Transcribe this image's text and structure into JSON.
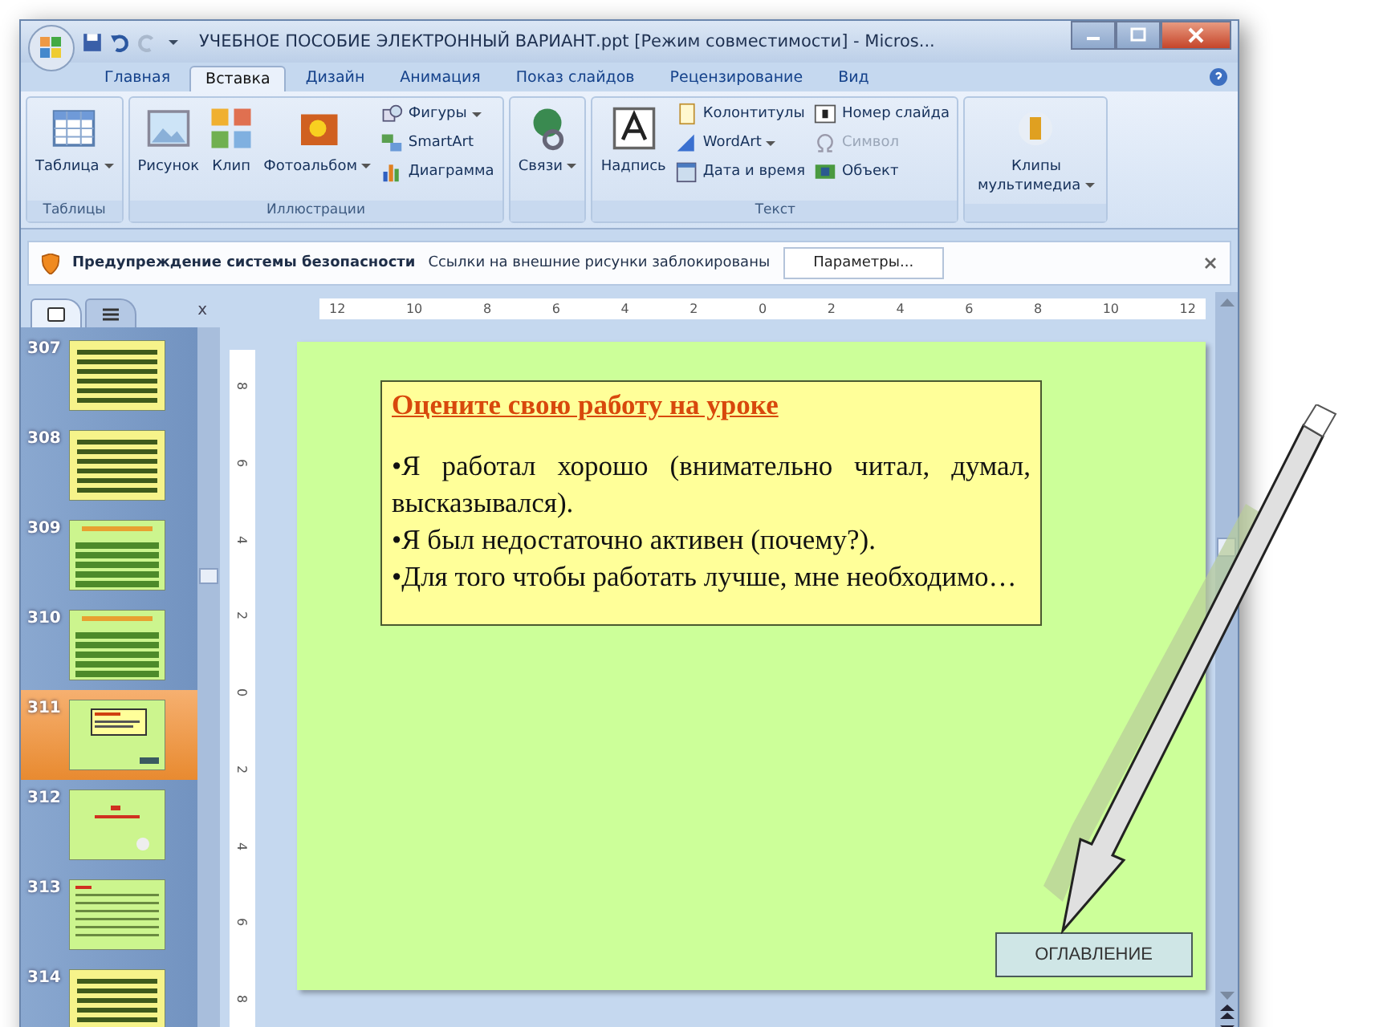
{
  "window": {
    "title": "УЧЕБНОЕ ПОСОБИЕ ЭЛЕКТРОННЫЙ ВАРИАНТ.ppt [Режим совместимости] - Micros..."
  },
  "ribbon_tabs": [
    {
      "label": "Главная",
      "selected": false
    },
    {
      "label": "Вставка",
      "selected": true
    },
    {
      "label": "Дизайн",
      "selected": false
    },
    {
      "label": "Анимация",
      "selected": false
    },
    {
      "label": "Показ слайдов",
      "selected": false
    },
    {
      "label": "Рецензирование",
      "selected": false
    },
    {
      "label": "Вид",
      "selected": false
    }
  ],
  "ribbon_groups": [
    {
      "label": "Таблицы",
      "items": [
        {
          "kind": "large",
          "label": "Таблица",
          "menu": true
        }
      ]
    },
    {
      "label": "Иллюстрации",
      "items": [
        {
          "kind": "large",
          "label": "Рисунок",
          "menu": false
        },
        {
          "kind": "large",
          "label": "Клип",
          "menu": false
        },
        {
          "kind": "large",
          "label": "Фотоальбом",
          "menu": true
        },
        {
          "kind": "column",
          "items": [
            {
              "label": "Фигуры",
              "menu": true,
              "disabled": false
            },
            {
              "label": "SmartArt",
              "menu": false,
              "disabled": false
            },
            {
              "label": "Диаграмма",
              "menu": false,
              "disabled": false
            }
          ]
        }
      ]
    },
    {
      "items": [
        {
          "kind": "large",
          "label": "Связи",
          "menu": true
        }
      ]
    },
    {
      "label": "Текст",
      "items": [
        {
          "kind": "large",
          "label": "Надпись",
          "menu": false
        },
        {
          "kind": "column",
          "items": [
            {
              "label": "Колонтитулы",
              "menu": false,
              "disabled": false
            },
            {
              "label": "WordArt",
              "menu": true,
              "disabled": false
            },
            {
              "label": "Дата и время",
              "menu": false,
              "disabled": false
            }
          ]
        },
        {
          "kind": "column",
          "items": [
            {
              "label": "Номер слайда",
              "menu": false,
              "disabled": false
            },
            {
              "label": "Символ",
              "menu": false,
              "disabled": true
            },
            {
              "label": "Объект",
              "menu": false,
              "disabled": false
            }
          ]
        }
      ]
    },
    {
      "items": [
        {
          "kind": "large",
          "label": "Клипы мультимедиа",
          "menu": true
        }
      ]
    }
  ],
  "security_bar": {
    "title": "Предупреждение системы безопасности",
    "message": "Ссылки на внешние рисунки заблокированы",
    "button": "Параметры..."
  },
  "slides_panel": {
    "close": "x",
    "slides": [
      {
        "number": "307",
        "kind": "yellow",
        "selected": false
      },
      {
        "number": "308",
        "kind": "yellow",
        "selected": false
      },
      {
        "number": "309",
        "kind": "green",
        "selected": false
      },
      {
        "number": "310",
        "kind": "green",
        "selected": false
      },
      {
        "number": "311",
        "kind": "current",
        "selected": true
      },
      {
        "number": "312",
        "kind": "title",
        "selected": false
      },
      {
        "number": "313",
        "kind": "lines",
        "selected": false
      },
      {
        "number": "314",
        "kind": "yellow",
        "selected": false
      }
    ]
  },
  "ruler_horizontal": [
    "12",
    "10",
    "8",
    "6",
    "4",
    "2",
    "0",
    "2",
    "4",
    "6",
    "8",
    "10",
    "12"
  ],
  "ruler_vertical": [
    "8",
    "6",
    "4",
    "2",
    "0",
    "2",
    "4",
    "6",
    "8"
  ],
  "slide": {
    "heading": "Оцените свою работу на уроке",
    "paragraphs": [
      "•Я работал хорошо (внимательно читал, думал, высказывался).",
      "•Я был недостаточно активен (почему?).",
      "•Для того чтобы работать лучше, мне необходимо…"
    ],
    "button": "ОГЛАВЛЕНИЕ"
  }
}
